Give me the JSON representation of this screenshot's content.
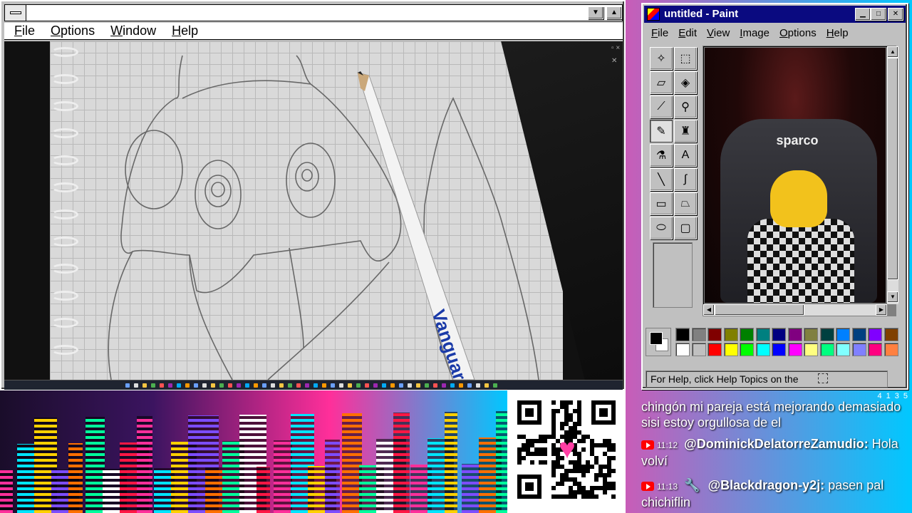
{
  "left_window": {
    "menu": [
      {
        "accel": "F",
        "rest": "ile"
      },
      {
        "accel": "O",
        "rest": "ptions"
      },
      {
        "accel": "W",
        "rest": "indow"
      },
      {
        "accel": "H",
        "rest": "elp"
      }
    ]
  },
  "paint": {
    "title": "untitled - Paint",
    "menu": [
      {
        "accel": "F",
        "rest": "ile"
      },
      {
        "accel": "E",
        "rest": "dit"
      },
      {
        "accel": "V",
        "rest": "iew"
      },
      {
        "accel": "I",
        "rest": "mage"
      },
      {
        "accel": "O",
        "rest": "ptions"
      },
      {
        "accel": "H",
        "rest": "elp"
      }
    ],
    "tools": [
      {
        "name": "free-select-tool",
        "glyph": "✧"
      },
      {
        "name": "rect-select-tool",
        "glyph": "⬚"
      },
      {
        "name": "eraser-tool",
        "glyph": "▱"
      },
      {
        "name": "fill-tool",
        "glyph": "◈"
      },
      {
        "name": "picker-tool",
        "glyph": "⟋"
      },
      {
        "name": "magnifier-tool",
        "glyph": "⚲"
      },
      {
        "name": "pencil-tool",
        "glyph": "✎"
      },
      {
        "name": "brush-tool",
        "glyph": "♜"
      },
      {
        "name": "airbrush-tool",
        "glyph": "⚗"
      },
      {
        "name": "text-tool",
        "glyph": "A"
      },
      {
        "name": "line-tool",
        "glyph": "╲"
      },
      {
        "name": "curve-tool",
        "glyph": "∫"
      },
      {
        "name": "rectangle-tool",
        "glyph": "▭"
      },
      {
        "name": "polygon-tool",
        "glyph": "⏢"
      },
      {
        "name": "ellipse-tool",
        "glyph": "⬭"
      },
      {
        "name": "rounded-rect-tool",
        "glyph": "▢"
      }
    ],
    "canvas_logo": "sparco",
    "palette_top": [
      "#000000",
      "#808080",
      "#800000",
      "#808000",
      "#008000",
      "#008080",
      "#000080",
      "#800080",
      "#808040",
      "#004040",
      "#0080ff",
      "#004080",
      "#8000ff",
      "#804000"
    ],
    "palette_bottom": [
      "#ffffff",
      "#c0c0c0",
      "#ff0000",
      "#ffff00",
      "#00ff00",
      "#00ffff",
      "#0000ff",
      "#ff00ff",
      "#ffff80",
      "#00ff80",
      "#80ffff",
      "#8080ff",
      "#ff0080",
      "#ff8040"
    ],
    "status": "For Help, click Help Topics on the"
  },
  "chat": {
    "header_counts": [
      "4",
      "1",
      "3",
      "5"
    ],
    "messages": [
      {
        "time": "",
        "user": "",
        "text": "chingón mi pareja está mejorando demasiado sisi estoy orgullosa de el"
      },
      {
        "time": "11:12",
        "user": "@DominickDelatorreZamudio:",
        "text": "Hola volví"
      },
      {
        "time": "11:13",
        "user": "@Blackdragon-y2j:",
        "text": "pasen pal chichiflin"
      }
    ]
  }
}
